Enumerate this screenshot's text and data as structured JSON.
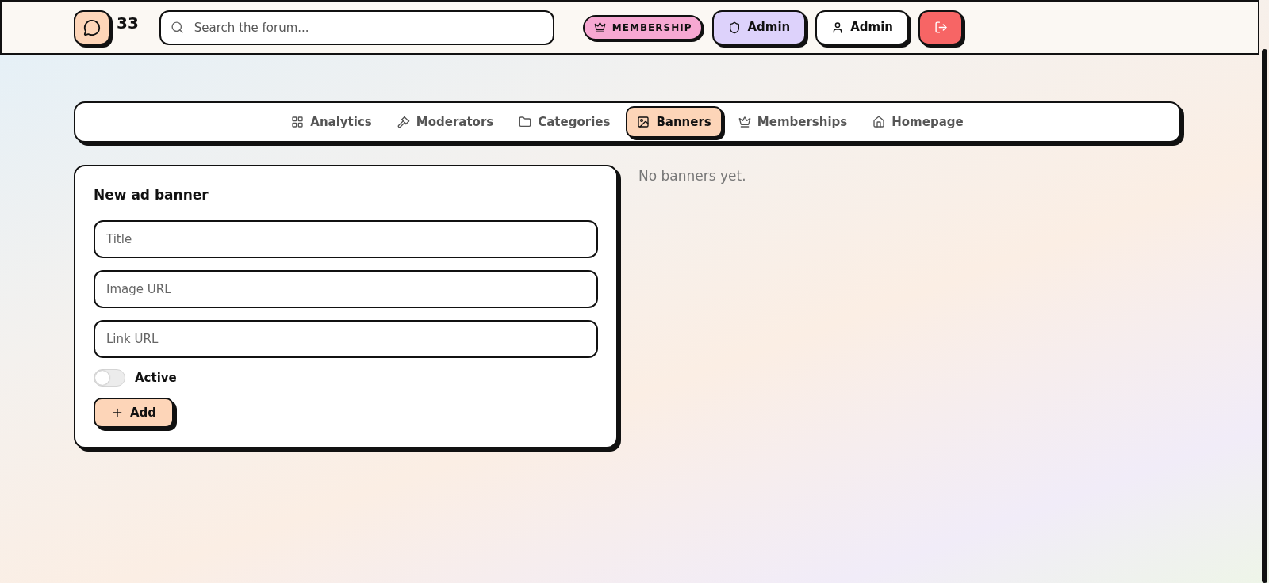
{
  "header": {
    "logo_count": "33",
    "search": {
      "placeholder": "Search the forum..."
    },
    "membership_badge": "MEMBERSHIP",
    "role_button": "Admin",
    "user_button": "Admin"
  },
  "tabs": [
    {
      "label": "Analytics",
      "selected": false
    },
    {
      "label": "Moderators",
      "selected": false
    },
    {
      "label": "Categories",
      "selected": false
    },
    {
      "label": "Banners",
      "selected": true
    },
    {
      "label": "Memberships",
      "selected": false
    },
    {
      "label": "Homepage",
      "selected": false
    }
  ],
  "form": {
    "title": "New ad banner",
    "fields": [
      {
        "placeholder": "Title"
      },
      {
        "placeholder": "Image URL"
      },
      {
        "placeholder": "Link URL"
      }
    ],
    "toggle": {
      "label": "Active",
      "on": false
    },
    "submit": "Add"
  },
  "empty_message": "No banners yet."
}
